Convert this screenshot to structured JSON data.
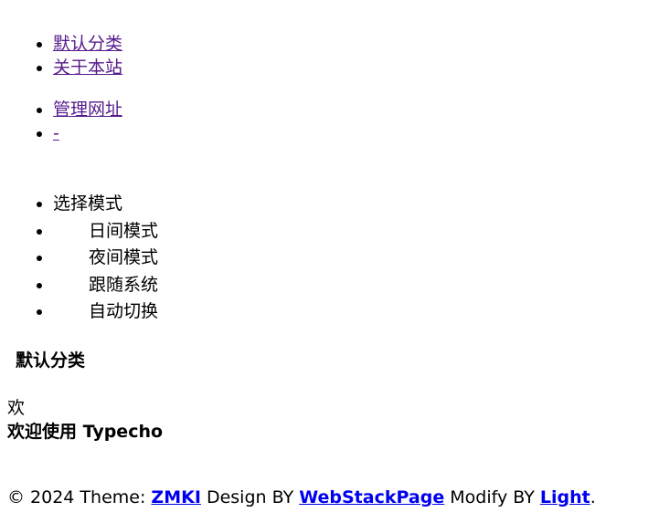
{
  "nav_primary": [
    "默认分类",
    "关于本站"
  ],
  "nav_secondary": [
    "管理网址",
    "-"
  ],
  "mode_menu": {
    "title": "选择模式",
    "options": [
      "日间模式",
      "夜间模式",
      "跟随系统",
      "自动切换"
    ]
  },
  "category": {
    "title": "默认分类"
  },
  "post": {
    "icon_char": "欢",
    "title": "欢迎使用 Typecho"
  },
  "footer": {
    "copyright": "© 2024 Theme: ",
    "theme_link": "ZMKI",
    "design_text": " Design BY ",
    "design_link": "WebStackPage",
    "modify_text": " Modify BY ",
    "modify_link": "Light",
    "end": "."
  },
  "colors": {
    "visited_link": "#551a8b",
    "link": "#0000ee"
  }
}
